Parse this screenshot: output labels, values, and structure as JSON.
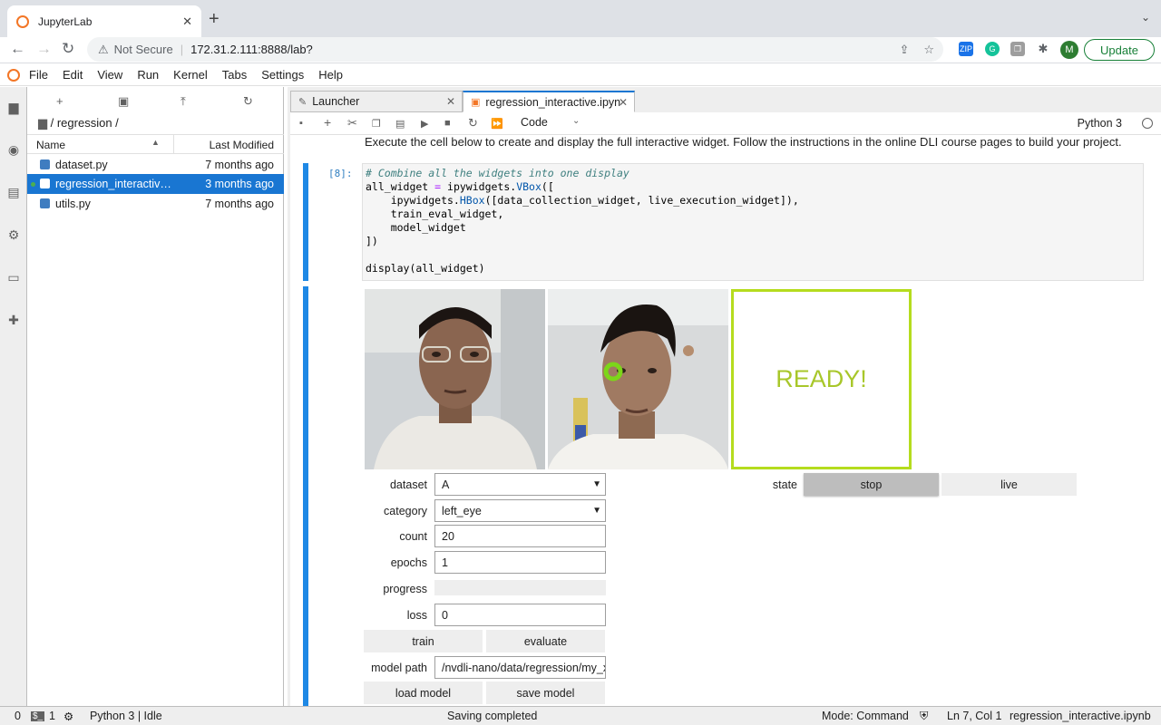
{
  "browser": {
    "tab_title": "JupyterLab",
    "tab_close": "✕",
    "new_tab": "+",
    "tab_search": "⌄",
    "url_warning": "Not Secure",
    "url": "172.31.2.111:8888/lab?",
    "profile_initial": "M",
    "update_label": "Update"
  },
  "menu": [
    "File",
    "Edit",
    "View",
    "Run",
    "Kernel",
    "Tabs",
    "Settings",
    "Help"
  ],
  "filebrowser": {
    "breadcrumb": "/ regression /",
    "col_name": "Name",
    "col_modified": "Last Modified",
    "files": [
      {
        "name": "dataset.py",
        "modified": "7 months ago"
      },
      {
        "name": "regression_interactive.ipynb",
        "modified": "3 months ago"
      },
      {
        "name": "utils.py",
        "modified": "7 months ago"
      }
    ]
  },
  "tabs": [
    {
      "label": "Launcher"
    },
    {
      "label": "regression_interactive.ipynb"
    }
  ],
  "notebook": {
    "cell_type": "Code",
    "kernel": "Python 3",
    "markdown": "Execute the cell below to create and display the full interactive widget. Follow the instructions in the online DLI course pages to build your project.",
    "prompt": "[8]:",
    "code_lines": [
      "# Combine all the widgets into one display",
      "all_widget = ipywidgets.VBox([",
      "    ipywidgets.HBox([data_collection_widget, live_execution_widget]),",
      "    train_eval_widget,",
      "    model_widget",
      "])",
      "",
      "display(all_widget)"
    ]
  },
  "widget": {
    "ready_text": "READY!",
    "state_label": "state",
    "stop_label": "stop",
    "live_label": "live",
    "dataset_label": "dataset",
    "dataset_value": "A",
    "category_label": "category",
    "category_value": "left_eye",
    "count_label": "count",
    "count_value": "20",
    "epochs_label": "epochs",
    "epochs_value": "1",
    "progress_label": "progress",
    "progress_value": 0,
    "loss_label": "loss",
    "loss_value": "0",
    "train_label": "train",
    "evaluate_label": "evaluate",
    "model_path_label": "model path",
    "model_path_value": "/nvdli-nano/data/regression/my_xy",
    "load_model_label": "load model",
    "save_model_label": "save model"
  },
  "status": {
    "zero": "0",
    "terminals": "1",
    "kernel_status": "Python 3 | Idle",
    "message": "Saving completed",
    "mode": "Mode: Command",
    "cursor": "Ln 7, Col 1",
    "filename": "regression_interactive.ipynb"
  },
  "colors": {
    "accent": "#1976d2",
    "ready": "#b5dc1e",
    "jupyter_orange": "#f37626"
  }
}
